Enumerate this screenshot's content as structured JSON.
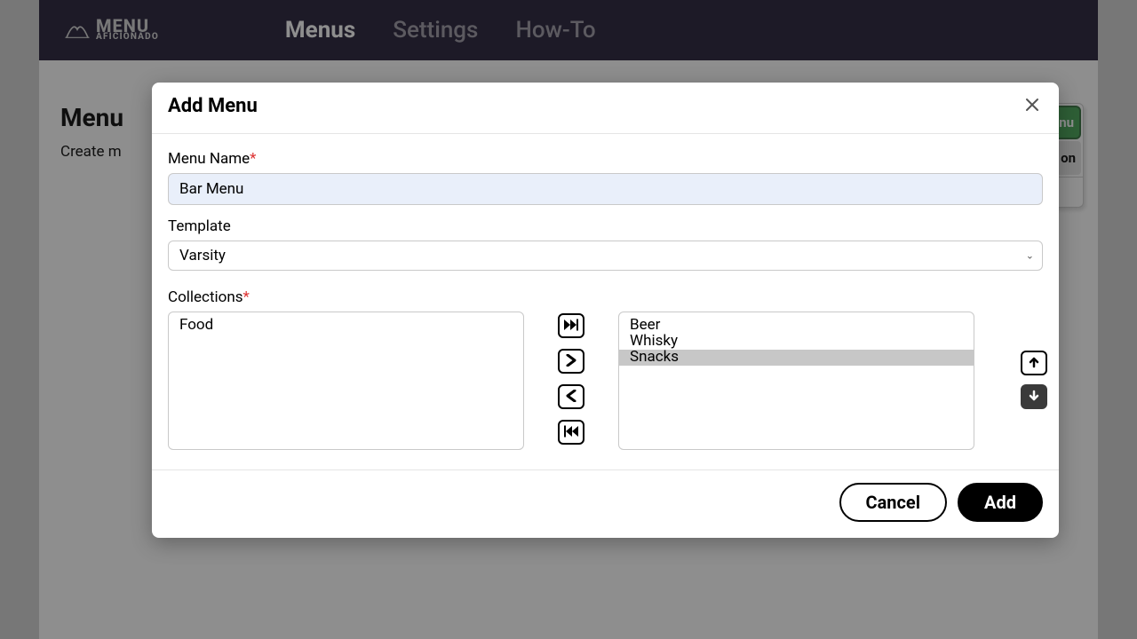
{
  "logo": {
    "line1": "MENU",
    "line2": "AFICIONADO"
  },
  "nav": {
    "menus": "Menus",
    "settings": "Settings",
    "howto": "How-To"
  },
  "page": {
    "title_fragment": "Menu",
    "subtitle_fragment": "Create m"
  },
  "right_card": {
    "btn1_suffix": "nu",
    "btn2_suffix": "on"
  },
  "modal": {
    "title": "Add Menu",
    "menu_name_label": "Menu Name",
    "menu_name_value": "Bar Menu",
    "template_label": "Template",
    "template_value": "Varsity",
    "collections_label": "Collections",
    "available": [
      "Food"
    ],
    "selected": [
      "Beer",
      "Whisky",
      "Snacks"
    ],
    "selected_highlight_index": 2,
    "cancel": "Cancel",
    "add": "Add"
  }
}
